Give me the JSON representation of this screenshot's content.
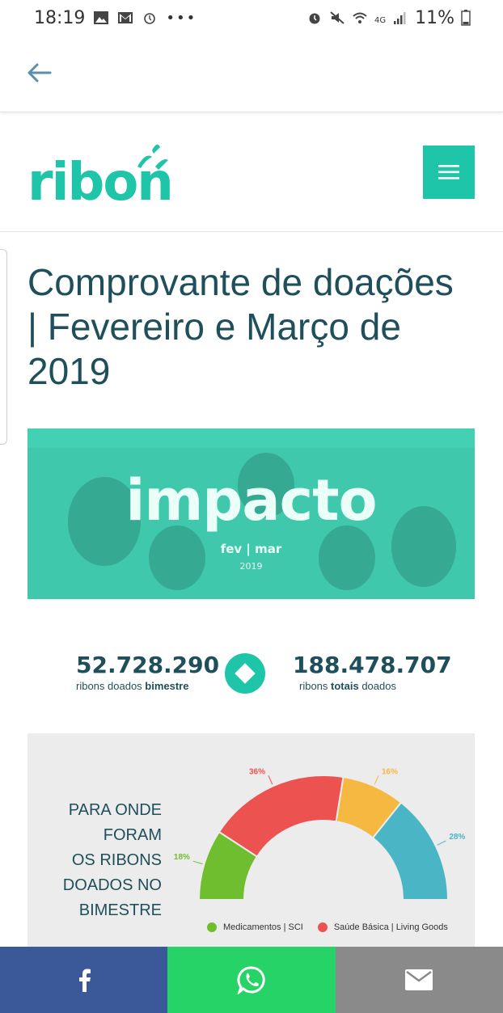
{
  "status_bar": {
    "time": "18:19",
    "network": "4G",
    "battery": "11%"
  },
  "header": {
    "logo_text": "ribon"
  },
  "page": {
    "title_line1": "Comprovante de doações",
    "title_line2": "| Fevereiro e Março de",
    "title_line3": "2019"
  },
  "banner": {
    "headline": "impacto",
    "period": "fev | mar",
    "year": "2019"
  },
  "stats": {
    "left_value": "52.728.290",
    "left_label": "ribons doados ",
    "left_label_bold": "bimestre",
    "right_value": "188.478.707",
    "right_label_pre": "ribons ",
    "right_label_bold": "totais",
    "right_label_post": " doados"
  },
  "chart_data": {
    "type": "pie",
    "title": "PARA ONDE FORAM OS RIBONS DOADOS NO BIMESTRE",
    "title_lines": [
      "PARA ONDE",
      "FORAM",
      "OS RIBONS",
      "DOADOS NO",
      "BIMESTRE"
    ],
    "slices": [
      {
        "label": "Medicamentos | SCI",
        "value": 18,
        "display": "18%",
        "color": "#6fbe2f"
      },
      {
        "label": "Saúde Básica | Living Goods",
        "value": 36,
        "display": "36%",
        "color": "#ec5350"
      },
      {
        "label": "",
        "value": 16,
        "display": "16%",
        "color": "#f5b841"
      },
      {
        "label": "",
        "value": 28,
        "display": "28%",
        "color": "#4ab5c4"
      }
    ],
    "legend": [
      {
        "label": "Medicamentos | SCI",
        "color": "#6fbe2f"
      },
      {
        "label": "Saúde Básica | Living Goods",
        "color": "#ec5350"
      }
    ]
  },
  "share": {
    "facebook_icon": "facebook-icon",
    "whatsapp_icon": "whatsapp-icon",
    "email_icon": "email-icon"
  },
  "colors": {
    "brand": "#1ec5a9",
    "text": "#1f4f5a"
  }
}
